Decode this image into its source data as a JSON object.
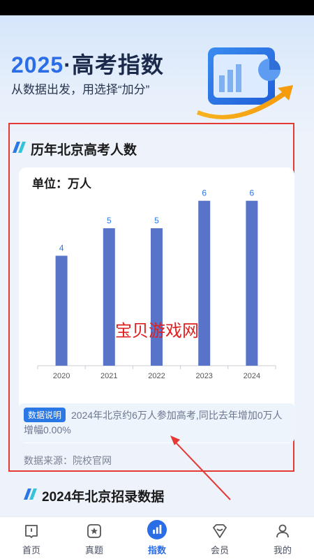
{
  "hero": {
    "year": "2025",
    "title_rest": "·高考指数",
    "subtitle": "从数据出发，用选择“加分”"
  },
  "section1": {
    "title": "历年北京高考人数"
  },
  "chart": {
    "unit": "单位：万人"
  },
  "chart_data": {
    "type": "bar",
    "categories": [
      "2020",
      "2021",
      "2022",
      "2023",
      "2024"
    ],
    "values": [
      4,
      5,
      5,
      6,
      6
    ],
    "ylim": [
      0,
      6.5
    ],
    "color": "#5874c8",
    "label_color": "#2a78e6"
  },
  "watermark": "宝贝游戏网",
  "note": {
    "badge": "数据说明",
    "text": "2024年北京约6万人参加高考,同比去年增加0万人增幅0.00%"
  },
  "source": "数据来源：院校官网",
  "section2": {
    "title": "2024年北京招录数据"
  },
  "tabs": [
    {
      "label": "首页",
      "icon": "home-icon"
    },
    {
      "label": "真题",
      "icon": "star-doc-icon"
    },
    {
      "label": "指数",
      "icon": "chart-icon"
    },
    {
      "label": "会员",
      "icon": "vip-icon"
    },
    {
      "label": "我的",
      "icon": "person-icon"
    }
  ],
  "active_tab": 2,
  "colors": {
    "accent": "#2a6de6",
    "highlight_border": "#e53935"
  }
}
